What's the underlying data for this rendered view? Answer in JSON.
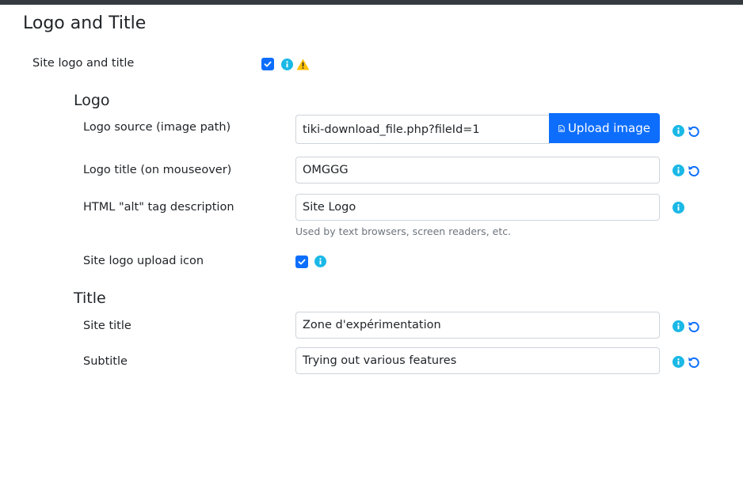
{
  "section_title": "Logo and Title",
  "main_pref": {
    "label": "Site logo and title",
    "checked": true
  },
  "logo_section": {
    "heading": "Logo",
    "logo_source": {
      "label": "Logo source (image path)",
      "value": "tiki-download_file.php?fileId=1",
      "button_label": "Upload image"
    },
    "logo_title": {
      "label": "Logo title (on mouseover)",
      "value": "OMGGG"
    },
    "alt_tag": {
      "label": "HTML \"alt\" tag description",
      "value": "Site Logo",
      "help": "Used by text browsers, screen readers, etc."
    },
    "upload_icon": {
      "label": "Site logo upload icon",
      "checked": true
    }
  },
  "title_section": {
    "heading": "Title",
    "site_title": {
      "label": "Site title",
      "value": "Zone d'expérimentation"
    },
    "subtitle": {
      "label": "Subtitle",
      "value": "Trying out various features"
    }
  },
  "icons": {
    "info": "info-circle-icon",
    "warning": "warning-triangle-icon",
    "reset": "reset-icon",
    "check": "check-icon",
    "image_file": "image-file-icon"
  },
  "colors": {
    "primary": "#0d6efd",
    "info": "#1ab8e6",
    "warning": "#ffc107",
    "help_text": "#6c757d"
  }
}
